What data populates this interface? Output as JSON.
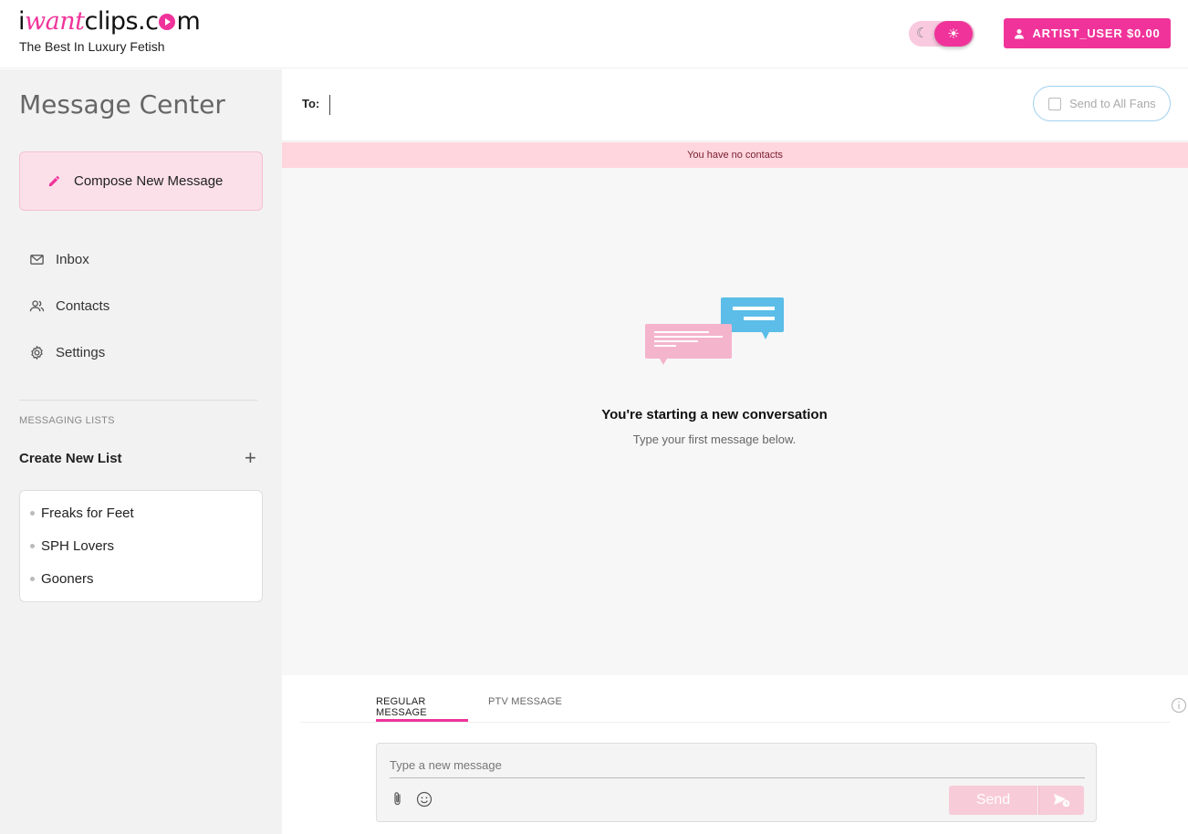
{
  "brand": {
    "logo_prefix": "i",
    "logo_want": "want",
    "logo_clips": "clips.c",
    "logo_suffix": "m",
    "tagline": "The Best In Luxury Fetish",
    "accent": "#f0339a"
  },
  "header": {
    "theme_toggle": {
      "moon_icon": "moon-icon",
      "sun_icon": "sun-icon",
      "active": "light"
    },
    "account_label": "ARTIST_USER $0.00"
  },
  "sidebar": {
    "title": "Message Center",
    "compose_label": "Compose New Message",
    "nav": {
      "inbox": "Inbox",
      "contacts": "Contacts",
      "settings": "Settings"
    },
    "lists_heading": "MESSAGING LISTS",
    "create_list_label": "Create New List",
    "create_list_plus": "+",
    "lists": [
      "Freaks for Feet",
      "SPH Lovers",
      "Gooners"
    ]
  },
  "main": {
    "to_label": "To:",
    "to_value": "",
    "send_all_label": "Send to All Fans",
    "alert": "You have no contacts",
    "empty_title": "You're starting a new conversation",
    "empty_subtitle": "Type your first message below.",
    "tabs": {
      "regular": "REGULAR MESSAGE",
      "ptv": "PTV MESSAGE",
      "active": "regular"
    },
    "message_placeholder": "Type a new message",
    "send_label": "Send"
  },
  "colors": {
    "pink_bubble": "#f4b4cc",
    "blue_bubble": "#5bbde8",
    "alert_bg": "#ffd6de"
  }
}
